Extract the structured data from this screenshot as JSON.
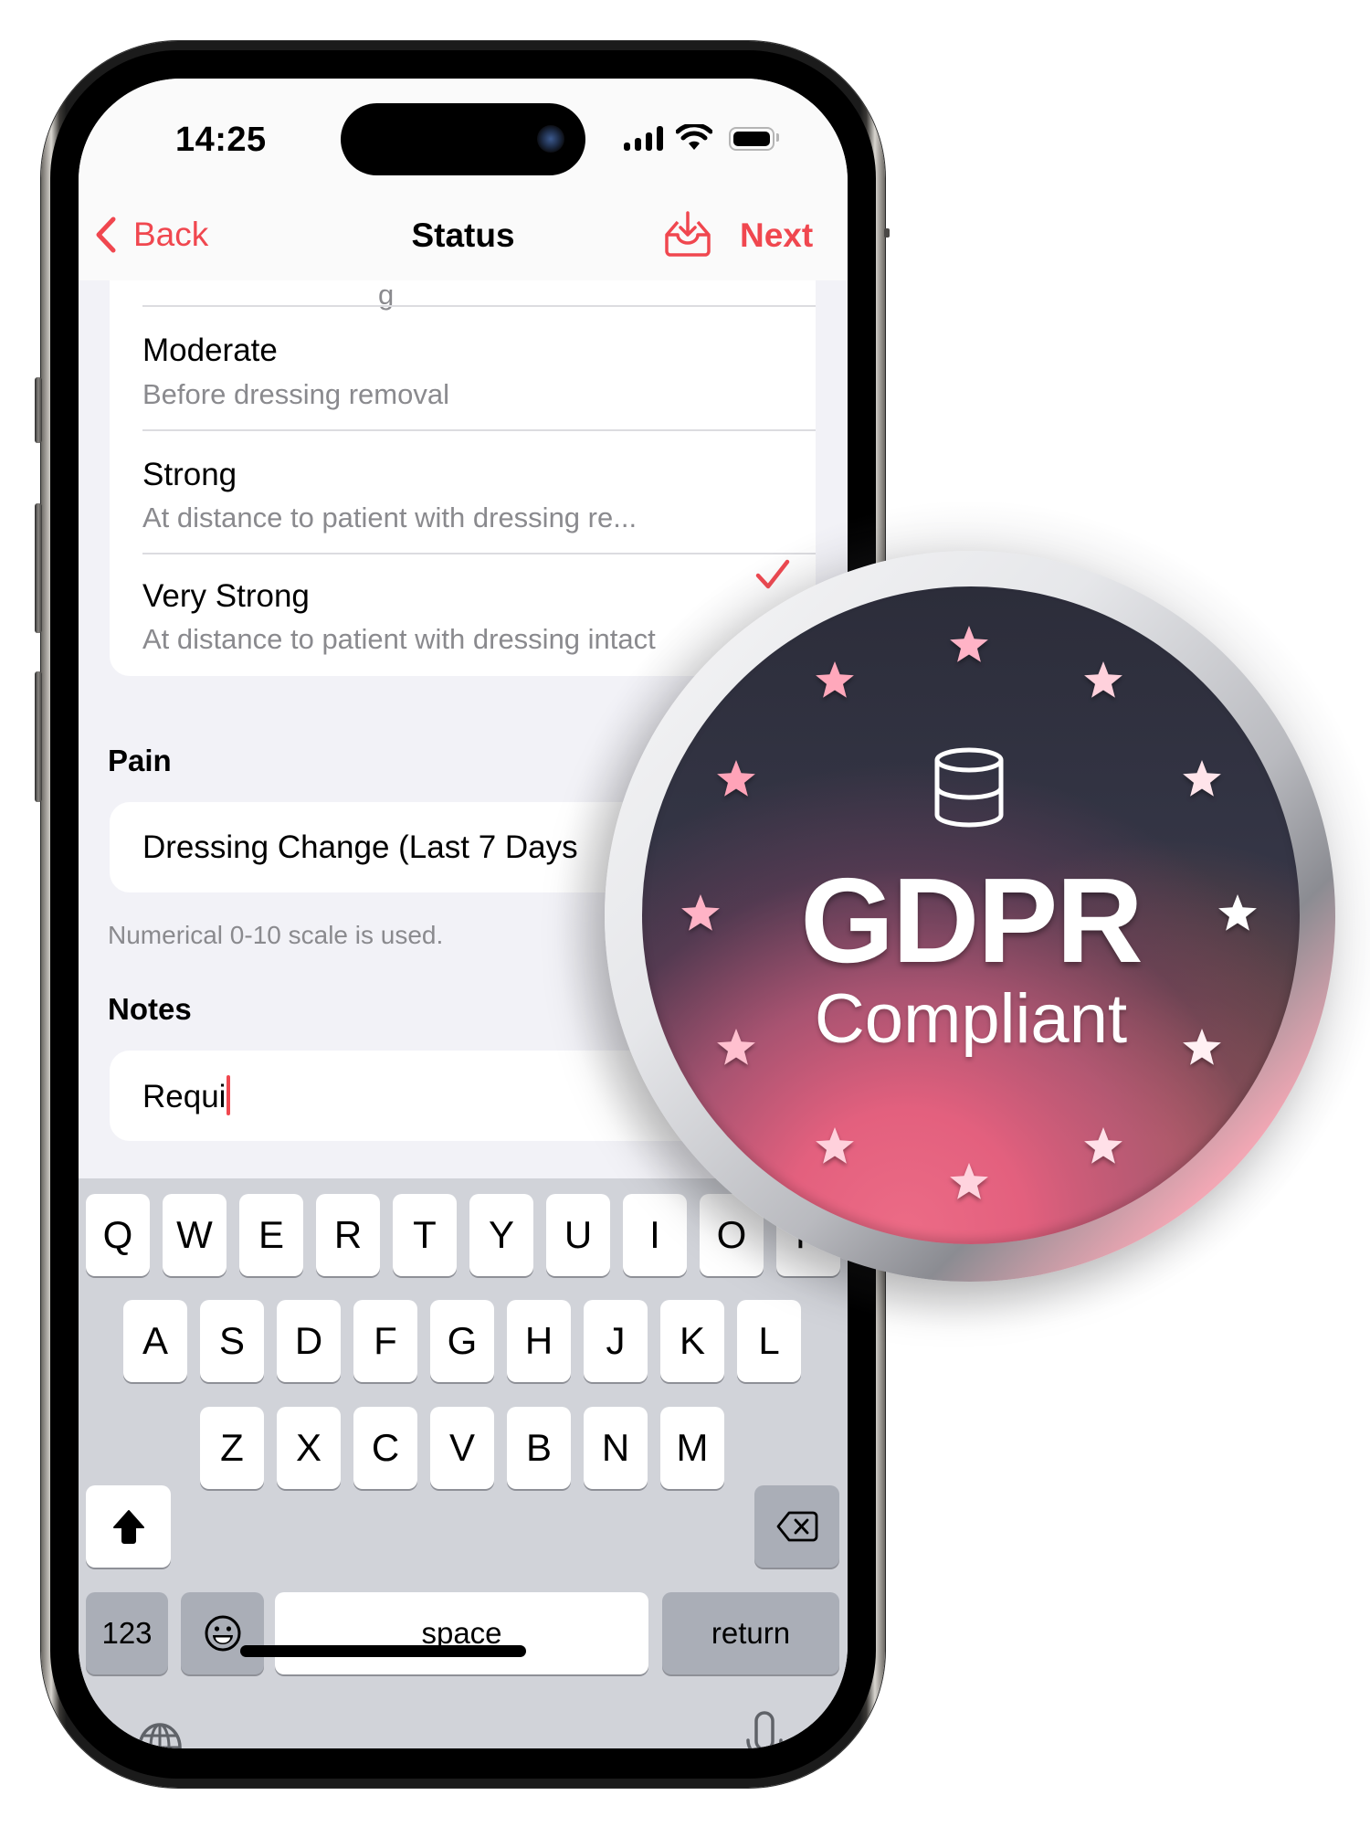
{
  "status_bar": {
    "time": "14:25",
    "icons": [
      "cellular-signal-icon",
      "wifi-icon",
      "battery-icon"
    ]
  },
  "nav": {
    "back_label": "Back",
    "title": "Status",
    "action_icon": "inbox-download-icon",
    "next_label": "Next"
  },
  "odor_list": {
    "partial_hidden_row_fragment": "g",
    "items": [
      {
        "title": "Moderate",
        "subtitle": "Before dressing removal",
        "selected": false
      },
      {
        "title": "Strong",
        "subtitle": "At distance to patient with dressing re...",
        "selected": true
      },
      {
        "title": "Very Strong",
        "subtitle": "At distance to patient with dressing intact",
        "selected": false
      }
    ]
  },
  "pain": {
    "header": "Pain",
    "field_value": "Dressing Change (Last 7 Days",
    "helper": "Numerical 0-10 scale is used."
  },
  "notes": {
    "header": "Notes",
    "value": "Requi"
  },
  "keyboard": {
    "rows": [
      [
        "Q",
        "W",
        "E",
        "R",
        "T",
        "Y",
        "U",
        "I",
        "O",
        "P"
      ],
      [
        "A",
        "S",
        "D",
        "F",
        "G",
        "H",
        "J",
        "K",
        "L"
      ],
      [
        "Z",
        "X",
        "C",
        "V",
        "B",
        "N",
        "M"
      ]
    ],
    "numbers_label": "123",
    "space_label": "space",
    "return_label": "return",
    "shift_icon": "shift-arrow-icon",
    "delete_icon": "delete-backspace-icon",
    "emoji_icon": "emoji-smiley-icon",
    "globe_icon": "globe-icon",
    "mic_icon": "microphone-icon"
  },
  "badge": {
    "icon": "database-icon",
    "title": "GDPR",
    "subtitle": "Compliant",
    "star_count": 12
  },
  "colors": {
    "accent": "#F0474F",
    "list_background": "#F2F2F7",
    "keyboard_background": "#D1D3D9",
    "key_dark": "#AAAEB7",
    "secondary_text": "#8A8A8E",
    "badge_dark": "#2C2D3A",
    "badge_pink": "#E8647F"
  }
}
